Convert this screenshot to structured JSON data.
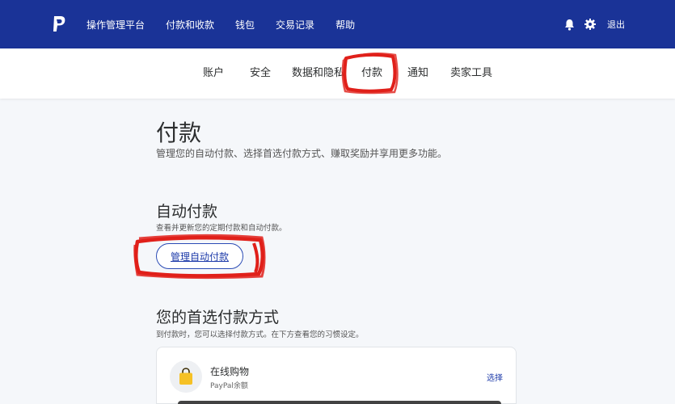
{
  "header": {
    "nav": [
      "操作管理平台",
      "付款和收款",
      "钱包",
      "交易记录",
      "帮助"
    ],
    "logout": "退出",
    "icons": [
      "paypal-logo",
      "bell-icon",
      "gear-icon"
    ],
    "bg_color": "#1a3397"
  },
  "subnav": {
    "tabs": [
      "账户",
      "安全",
      "数据和隐私",
      "付款",
      "通知",
      "卖家工具"
    ],
    "active": "付款"
  },
  "page": {
    "title": "付款",
    "subtitle": "管理您的自动付款、选择首选付款方式、赚取奖励并享用更多功能。"
  },
  "auto_payments": {
    "title": "自动付款",
    "subtitle": "查看并更新您的定期付款和自动付款。",
    "button": "管理自动付款"
  },
  "preferred": {
    "title": "您的首选付款方式",
    "subtitle": "到付款时，您可以选择付款方式。在下方查看您的习惯设定。",
    "card": {
      "name": "在线购物",
      "balance": "PayPal余额",
      "action": "选择",
      "icon": "shopping-bag-icon"
    }
  },
  "annotation_color": "#e0201a"
}
